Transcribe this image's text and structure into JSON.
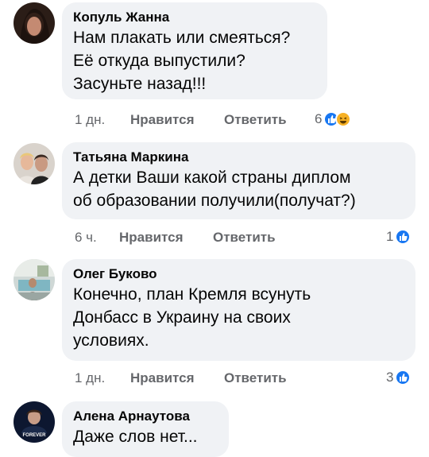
{
  "comments": [
    {
      "author": "Копуль Жанна",
      "text": "Нам плакать или смеяться?\nЕё откуда выпустили?\nЗасуньте назад!!!",
      "time": "1 дн.",
      "like_label": "Нравится",
      "reply_label": "Ответить",
      "reaction_count": "6",
      "reactions": [
        "like-icon",
        "haha-icon"
      ]
    },
    {
      "author": "Татьяна Маркина",
      "text": "А детки Ваши какой страны диплом\nоб образовании получили(получат?)",
      "time": "6 ч.",
      "like_label": "Нравится",
      "reply_label": "Ответить",
      "reaction_count": "1",
      "reactions": [
        "like-icon"
      ]
    },
    {
      "author": "Олег Буково",
      "text": "Конечно, план Кремля всунуть\nДонбасс в Украину на своих\nусловиях.",
      "time": "1 дн.",
      "like_label": "Нравится",
      "reply_label": "Ответить",
      "reaction_count": "3",
      "reactions": [
        "like-icon"
      ]
    },
    {
      "author": "Алена Арнаутова",
      "text": "Даже слов нет...",
      "avatar_caption": "FOREVER"
    }
  ],
  "colors": {
    "bubble": "#f0f2f5",
    "meta": "#65676b",
    "like": "#1877f2",
    "haha": "#f7b125"
  }
}
